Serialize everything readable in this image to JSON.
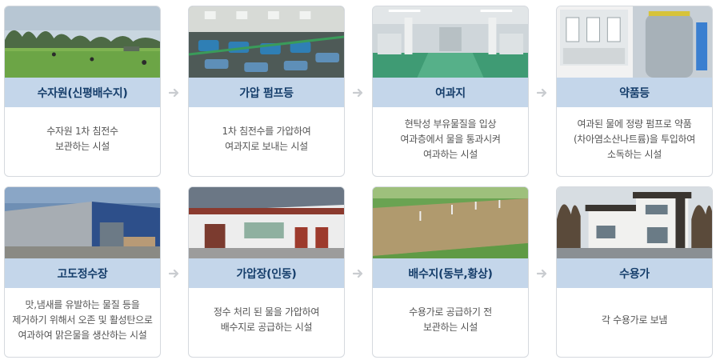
{
  "steps": [
    {
      "title": "수자원(신평배수지)",
      "desc": "수자원 1차 침전수\n보관하는 시설"
    },
    {
      "title": "가압 펌프등",
      "desc": "1차 침전수를 가압하여\n여과지로 보내는 시설"
    },
    {
      "title": "여과지",
      "desc": "현탁성 부유물질을 입상\n여과층에서 물을 통과시켜\n여과하는 시설"
    },
    {
      "title": "약품등",
      "desc": "여과된 물에 정량 펌프로 약품\n(차아염소산나트륨)을 투입하여\n소독하는 시설"
    },
    {
      "title": "고도정수장",
      "desc": "맛,냄새를 유발하는 물질 등을\n제거하기 위해서 오존 및 활성탄으로\n여과하여 맑은물을 생산하는 시설"
    },
    {
      "title": "가압장(인동)",
      "desc": "정수 처리 된 물을 가압하여\n배수지로 공급하는 시설"
    },
    {
      "title": "배수지(동부,황상)",
      "desc": "수용가로 공급하기 전\n보관하는 시설"
    },
    {
      "title": "수용가",
      "desc": "각 수용가로 보냄"
    }
  ],
  "icons": {
    "arrow": "arrow-right-icon"
  },
  "colors": {
    "title_bg": "#c4d6ea",
    "title_text": "#163e6b",
    "arrow": "#c9ccd0"
  }
}
